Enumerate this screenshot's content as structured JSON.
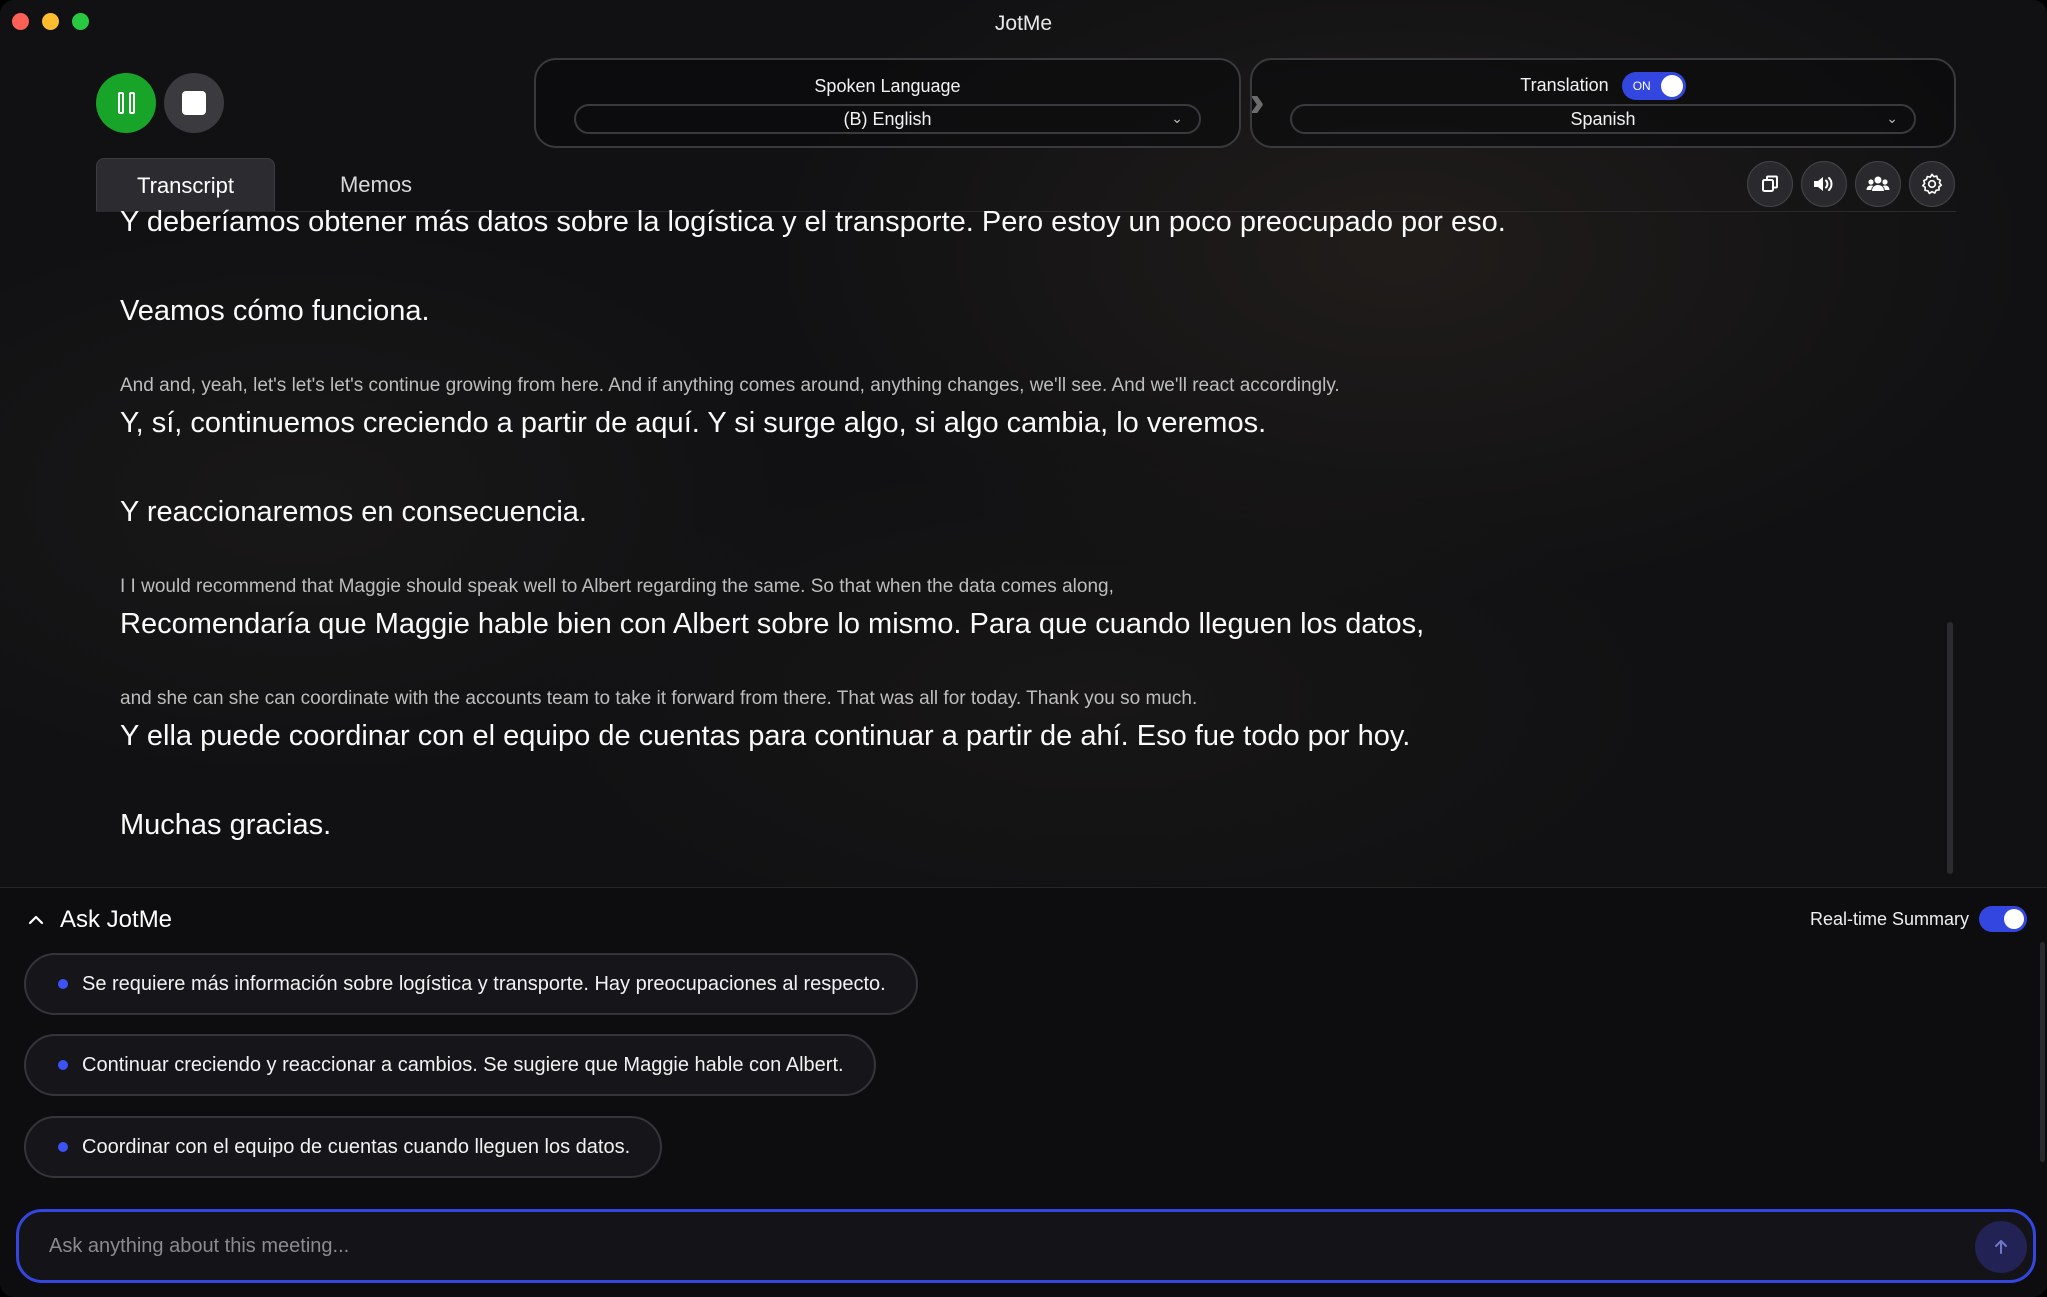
{
  "window": {
    "title": "JotMe"
  },
  "controls": {
    "pause_icon": "pause-icon",
    "stop_icon": "stop-icon"
  },
  "spoken": {
    "label": "Spoken Language",
    "value": "(B) English"
  },
  "translation": {
    "label": "Translation",
    "toggle_text": "ON",
    "value": "Spanish"
  },
  "tabs": [
    {
      "label": "Transcript",
      "active": true
    },
    {
      "label": "Memos",
      "active": false
    }
  ],
  "toolbar": [
    "copy-icon",
    "speaker-icon",
    "people-icon",
    "gear-icon"
  ],
  "transcript": [
    {
      "lang": "es",
      "text": "Y deberíamos obtener más datos sobre la logística y el transporte. Pero estoy un poco preocupado por eso."
    },
    {
      "lang": "es",
      "text": "Veamos cómo funciona."
    },
    {
      "lang": "en",
      "text": "And and, yeah, let's let's let's continue growing from here. And if anything comes around, anything changes, we'll see. And we'll react accordingly."
    },
    {
      "lang": "es",
      "text": "Y, sí, continuemos creciendo a partir de aquí. Y si surge algo, si algo cambia, lo veremos."
    },
    {
      "lang": "es",
      "text": "Y reaccionaremos en consecuencia."
    },
    {
      "lang": "en",
      "text": "I I would recommend that Maggie should speak well to Albert regarding the same. So that when the data comes along,"
    },
    {
      "lang": "es",
      "text": "Recomendaría que Maggie hable bien con Albert sobre lo mismo. Para que cuando lleguen los datos,"
    },
    {
      "lang": "en",
      "text": "and she can she can coordinate with the accounts team to take it forward from there. That was all for today. Thank you so much."
    },
    {
      "lang": "es",
      "text": "Y ella puede coordinar con el equipo de cuentas para continuar a partir de ahí. Eso fue todo por hoy."
    },
    {
      "lang": "es",
      "text": "Muchas gracias."
    }
  ],
  "ask": {
    "title": "Ask JotMe",
    "realtime_label": "Real-time Summary",
    "suggestions": [
      "Se requiere más información sobre logística y transporte. Hay preocupaciones al respecto.",
      "Continuar creciendo y reaccionar a cambios. Se sugiere que Maggie hable con Albert.",
      "Coordinar con el equipo de cuentas cuando lleguen los datos."
    ],
    "placeholder": "Ask anything about this meeting..."
  },
  "colors": {
    "accent": "#3347e0",
    "record_green": "#18a428",
    "bullet": "#3d52f5"
  }
}
